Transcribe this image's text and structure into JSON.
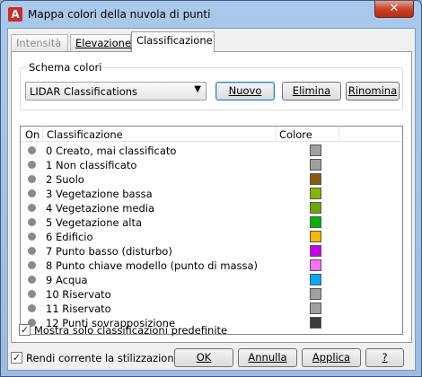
{
  "window": {
    "title": "Mappa colori della nuvola di punti",
    "app_icon": "autocad-a-icon",
    "close_label": "✕"
  },
  "tabs": [
    {
      "label": "Intensità",
      "state": "disabled"
    },
    {
      "label": "Elevazione",
      "state": "normal"
    },
    {
      "label": "Classificazione",
      "state": "active"
    }
  ],
  "scheme": {
    "group_label": "Schema colori",
    "selected": "LIDAR Classifications",
    "new_label": "Nuovo",
    "delete_label": "Elimina",
    "rename_label": "Rinomina"
  },
  "list": {
    "headers": {
      "on": "On",
      "classification": "Classificazione",
      "color": "Colore"
    },
    "rows": [
      {
        "label": "0 Creato, mai classificato",
        "color": "#a0a0a0"
      },
      {
        "label": "1 Non classificato",
        "color": "#a0a0a0"
      },
      {
        "label": "2 Suolo",
        "color": "#8b5a14"
      },
      {
        "label": "3 Vegetazione bassa",
        "color": "#84b400"
      },
      {
        "label": "4 Vegetazione media",
        "color": "#6aa800"
      },
      {
        "label": "5 Vegetazione alta",
        "color": "#00b400"
      },
      {
        "label": "6 Edificio",
        "color": "#ffb400"
      },
      {
        "label": "7 Punto basso (disturbo)",
        "color": "#c800e6"
      },
      {
        "label": "8 Punto chiave modello (punto di massa)",
        "color": "#ff6eff"
      },
      {
        "label": "9 Acqua",
        "color": "#00aaff"
      },
      {
        "label": "10 Riservato",
        "color": "#a0a0a0"
      },
      {
        "label": "11 Riservato",
        "color": "#a0a0a0"
      },
      {
        "label": "12 Punti sovrapposizione",
        "color": "#3c3c3c"
      }
    ]
  },
  "options": {
    "show_predefined_label": "Mostra solo classificazioni predefinite",
    "show_predefined_checked": true
  },
  "footer": {
    "make_current_label": "Rendi corrente la stilizzazione",
    "make_current_checked": true,
    "ok_label": "OK",
    "cancel_label": "Annulla",
    "apply_label": "Applica",
    "help_label": "?"
  }
}
